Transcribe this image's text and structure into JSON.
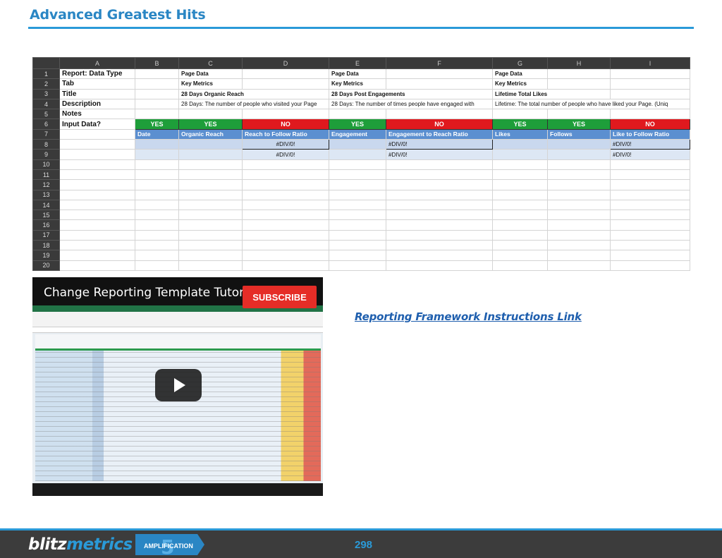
{
  "page": {
    "title": "Advanced Greatest Hits",
    "link_text": "Reporting Framework Instructions Link",
    "page_number": "298"
  },
  "sheet": {
    "columns": [
      "",
      "A",
      "B",
      "C",
      "D",
      "E",
      "F",
      "G",
      "H",
      "I"
    ],
    "row_numbers": [
      "1",
      "2",
      "3",
      "4",
      "5",
      "6",
      "7",
      "8",
      "9",
      "10",
      "11",
      "12",
      "13",
      "14",
      "15",
      "16",
      "17",
      "18",
      "19",
      "20"
    ],
    "labels": [
      "Report: Data Type",
      "Tab",
      "Title",
      "Description",
      "Notes",
      "Input Data?"
    ],
    "c": {
      "r1": "Page Data",
      "r2": "Key Metrics",
      "r3": "28 Days Organic Reach",
      "r4": "28 Days: The number of people who visited your Page"
    },
    "e": {
      "r1": "Page Data",
      "r2": "Key Metrics",
      "r3": "28 Days Post Engagements",
      "r4": "28 Days: The number of times people have engaged with"
    },
    "g": {
      "r1": "Page Data",
      "r2": "Key Metrics",
      "r3": "Lifetime Total Likes",
      "r4": "Lifetime: The total number of people who have liked your Page. (Uniq"
    },
    "input": [
      "YES",
      "YES",
      "NO",
      "YES",
      "NO",
      "YES",
      "YES",
      "NO"
    ],
    "headers": [
      "Date",
      "Organic Reach",
      "Reach to Follow Ratio",
      "Engagement",
      "Engagement to Reach Ratio",
      "Likes",
      "Follows",
      "Like to Follow Ratio"
    ],
    "error": "#DIV/0!"
  },
  "video": {
    "title": "Change Reporting Template Tutori...",
    "subscribe_label": "SUBSCRIBE",
    "play_icon": "play-icon"
  },
  "footer": {
    "logo_part1": "blitz",
    "logo_part2": "metrics",
    "badge_text": "AMPLIFICATION",
    "badge_number": "5"
  },
  "colors": {
    "accent": "#2a9ad8",
    "yes": "#1e9e3a",
    "no": "#e0191e",
    "header_blue": "#5b8fd0"
  }
}
